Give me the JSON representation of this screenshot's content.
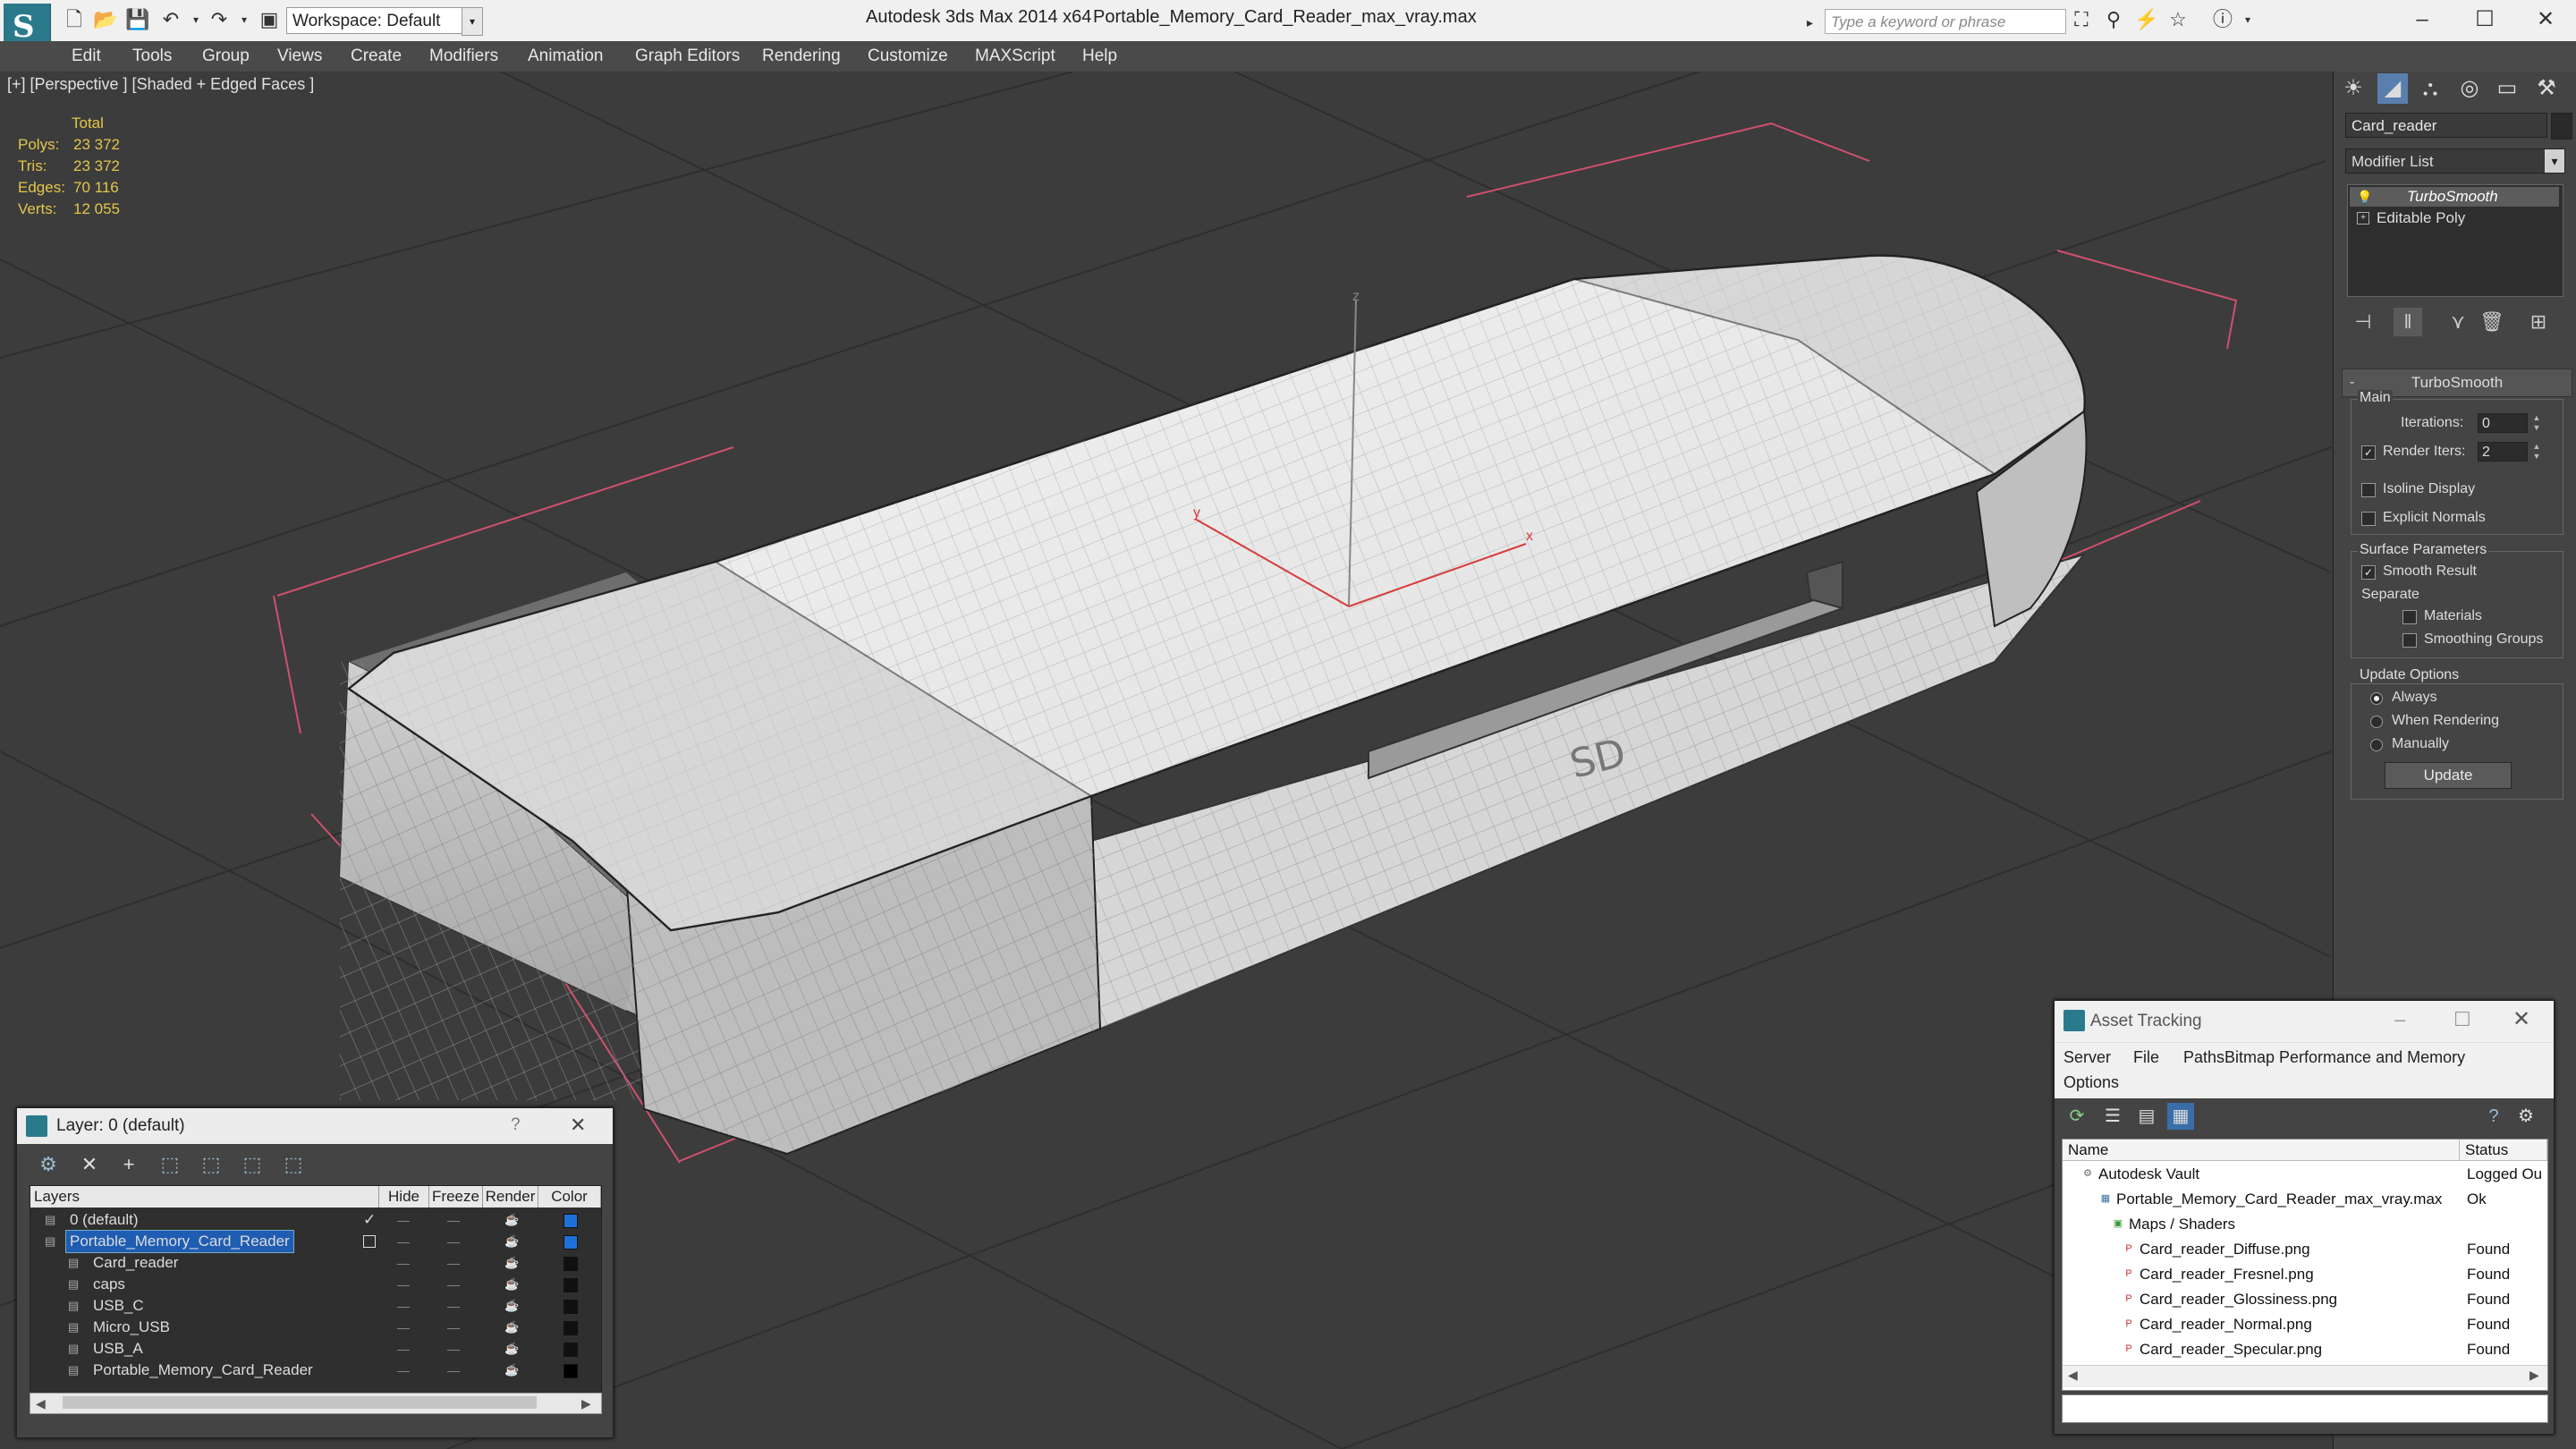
{
  "titlebar": {
    "workspace": "Workspace: Default",
    "app": "Autodesk 3ds Max  2014 x64",
    "file": "Portable_Memory_Card_Reader_max_vray.max",
    "search_placeholder": "Type a keyword or phrase"
  },
  "menu": [
    "Edit",
    "Tools",
    "Group",
    "Views",
    "Create",
    "Modifiers",
    "Animation",
    "Graph Editors",
    "Rendering",
    "Customize",
    "MAXScript",
    "Help"
  ],
  "viewport": {
    "label": "[+] [Perspective ] [Shaded + Edged Faces ]",
    "stats": {
      "header": "Total",
      "rows": [
        {
          "label": "Polys:",
          "value": "23 372"
        },
        {
          "label": "Tris:",
          "value": "23 372"
        },
        {
          "label": "Edges:",
          "value": "70 116"
        },
        {
          "label": "Verts:",
          "value": "12 055"
        }
      ]
    },
    "gizmo": {
      "x": "x",
      "y": "y",
      "z": "z"
    },
    "model_text": "SD"
  },
  "panel": {
    "object_name": "Card_reader",
    "modifier_list": "Modifier List",
    "stack": [
      "TurboSmooth",
      "Editable Poly"
    ],
    "rollout": "TurboSmooth",
    "main": {
      "title": "Main",
      "iterations_label": "Iterations:",
      "iterations": "0",
      "render_iters_label": "Render Iters:",
      "render_iters": "2",
      "isoline": "Isoline Display",
      "explicit": "Explicit Normals"
    },
    "surface": {
      "title": "Surface Parameters",
      "smooth": "Smooth Result",
      "separate": "Separate",
      "materials": "Materials",
      "groups": "Smoothing Groups"
    },
    "update": {
      "title": "Update Options",
      "always": "Always",
      "when_rendering": "When Rendering",
      "manually": "Manually",
      "button": "Update"
    }
  },
  "layer_window": {
    "title": "Layer: 0 (default)",
    "help": "?",
    "headers": [
      "Layers",
      "Hide",
      "Freeze",
      "Render",
      "Color"
    ],
    "rows": [
      {
        "name": "0 (default)",
        "color": "#1f6fd8"
      },
      {
        "name": "Portable_Memory_Card_Reader",
        "color": "#1f6fd8"
      },
      {
        "name": "Card_reader",
        "color": "#101010"
      },
      {
        "name": "caps",
        "color": "#101010"
      },
      {
        "name": "USB_C",
        "color": "#101010"
      },
      {
        "name": "Micro_USB",
        "color": "#101010"
      },
      {
        "name": "USB_A",
        "color": "#101010"
      },
      {
        "name": "Portable_Memory_Card_Reader",
        "color": "#000000"
      }
    ],
    "dash": "—"
  },
  "asset_window": {
    "title": "Asset Tracking",
    "menu": [
      "Server",
      "File",
      "Paths",
      "Bitmap Performance and Memory",
      "Options"
    ],
    "headers": [
      "Name",
      "Status"
    ],
    "rows": [
      {
        "name": "Autodesk Vault",
        "status": "Logged Ou"
      },
      {
        "name": "Portable_Memory_Card_Reader_max_vray.max",
        "status": "Ok"
      },
      {
        "name": "Maps / Shaders",
        "status": ""
      },
      {
        "name": "Card_reader_Diffuse.png",
        "status": "Found"
      },
      {
        "name": "Card_reader_Fresnel.png",
        "status": "Found"
      },
      {
        "name": "Card_reader_Glossiness.png",
        "status": "Found"
      },
      {
        "name": "Card_reader_Normal.png",
        "status": "Found"
      },
      {
        "name": "Card_reader_Specular.png",
        "status": "Found"
      }
    ]
  },
  "colors": {
    "accent": "#1f5db3",
    "stat_text": "#e2c64a",
    "selection_box": "#d0506e"
  }
}
